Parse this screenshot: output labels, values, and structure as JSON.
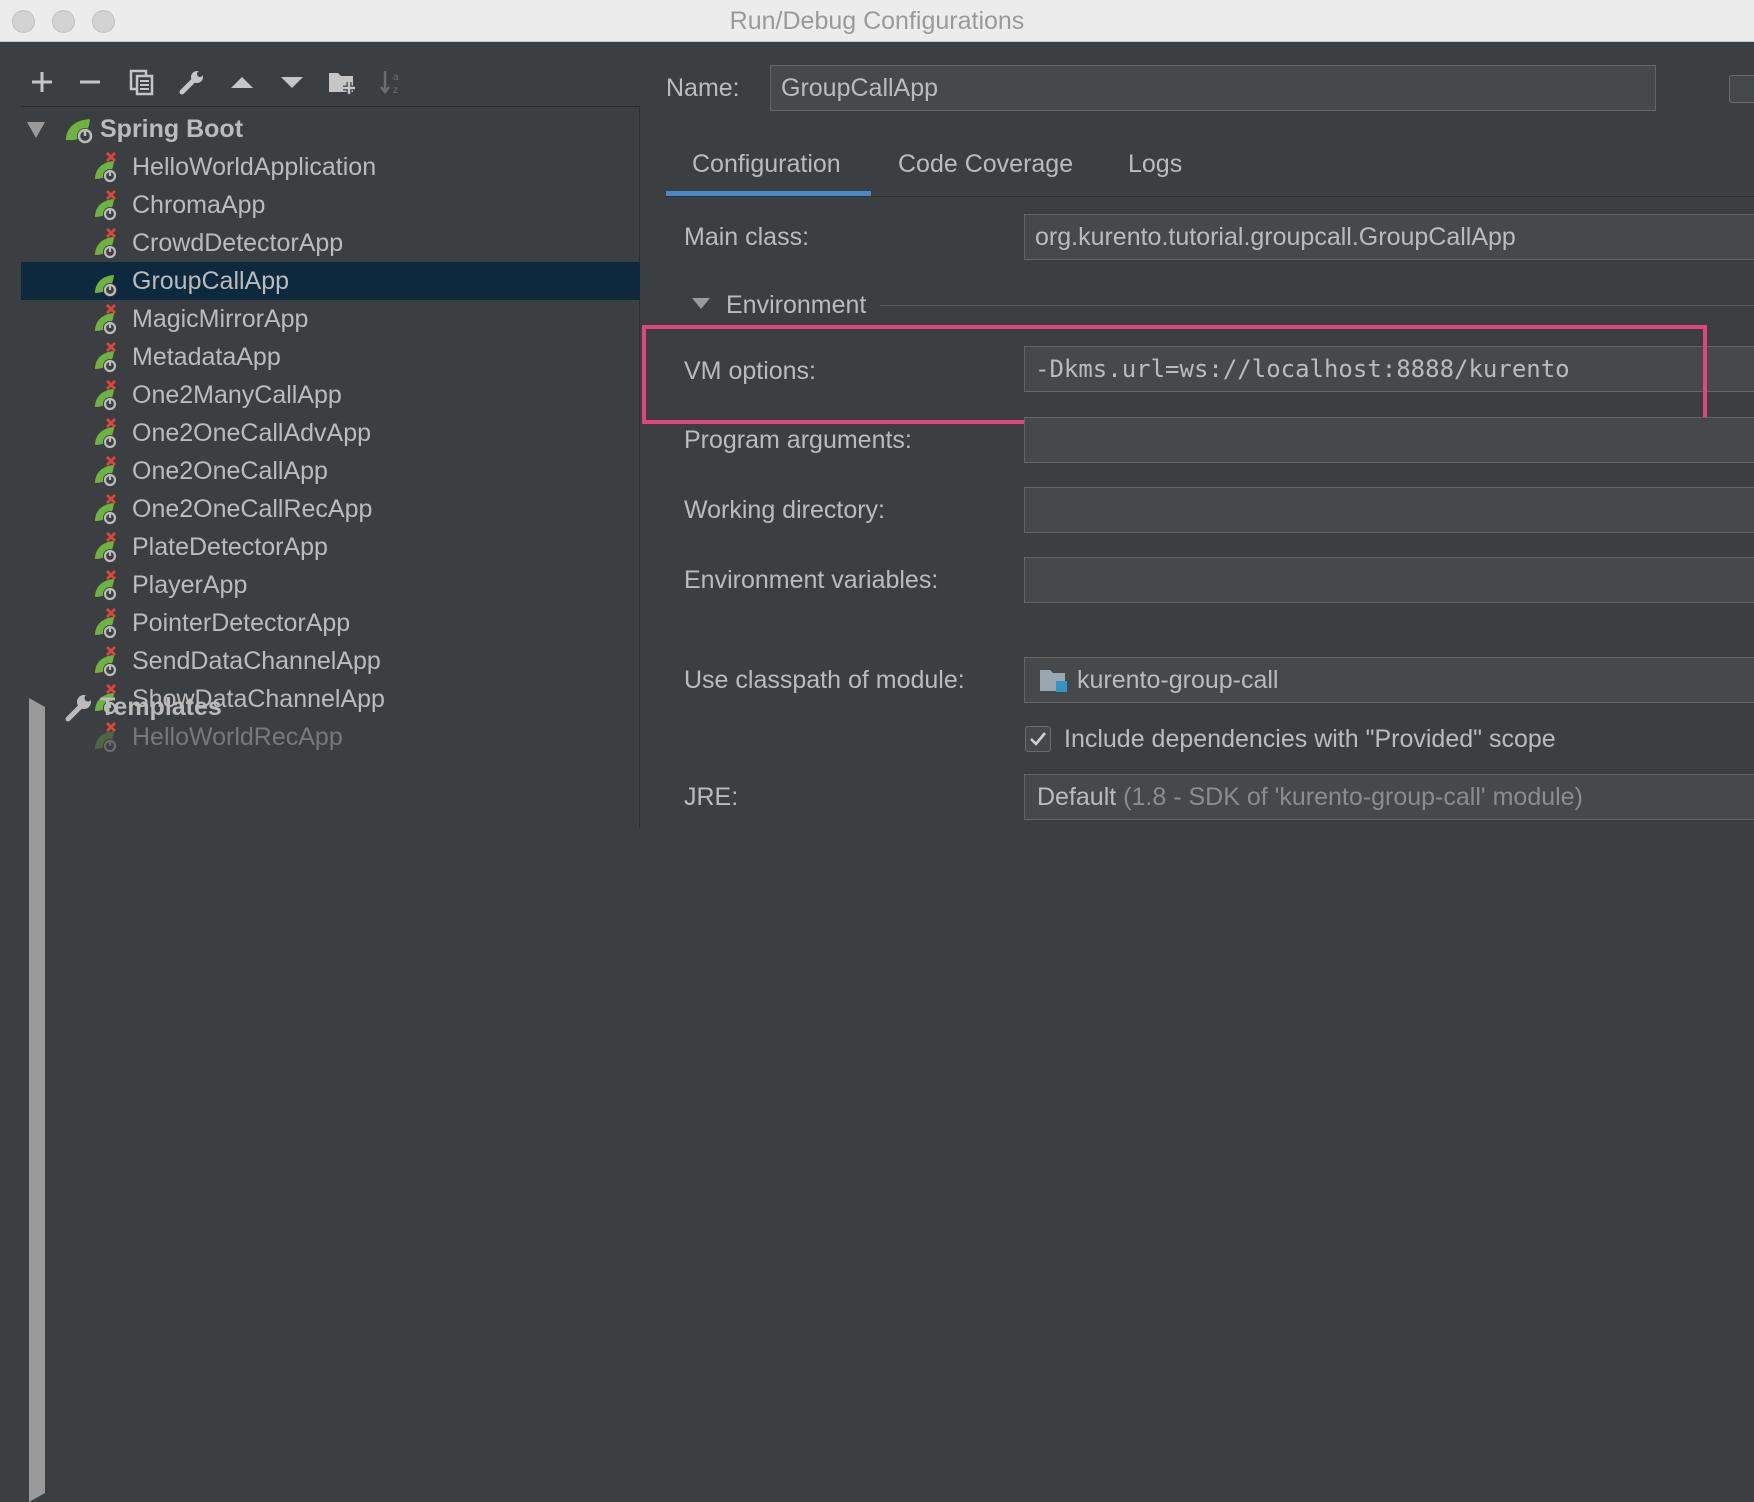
{
  "window": {
    "title": "Run/Debug Configurations"
  },
  "toolbar": {
    "buttons": [
      {
        "name": "add",
        "glyph": "+"
      },
      {
        "name": "remove",
        "glyph": "−"
      },
      {
        "name": "copy",
        "glyph": "copy-icon"
      },
      {
        "name": "edit-defaults",
        "glyph": "wrench-icon"
      },
      {
        "name": "move-up",
        "glyph": "▲"
      },
      {
        "name": "move-down",
        "glyph": "▼"
      },
      {
        "name": "new-folder",
        "glyph": "folder-plus-icon"
      },
      {
        "name": "sort",
        "glyph": "sort-az-icon"
      }
    ]
  },
  "tree": {
    "root_label": "Spring Boot",
    "items": [
      {
        "label": "HelloWorldApplication",
        "error": true
      },
      {
        "label": "ChromaApp",
        "error": true
      },
      {
        "label": "CrowdDetectorApp",
        "error": true
      },
      {
        "label": "GroupCallApp",
        "error": false,
        "selected": true
      },
      {
        "label": "MagicMirrorApp",
        "error": true
      },
      {
        "label": "MetadataApp",
        "error": true
      },
      {
        "label": "One2ManyCallApp",
        "error": true
      },
      {
        "label": "One2OneCallAdvApp",
        "error": true
      },
      {
        "label": "One2OneCallApp",
        "error": true
      },
      {
        "label": "One2OneCallRecApp",
        "error": true
      },
      {
        "label": "PlateDetectorApp",
        "error": true
      },
      {
        "label": "PlayerApp",
        "error": true
      },
      {
        "label": "PointerDetectorApp",
        "error": true
      },
      {
        "label": "SendDataChannelApp",
        "error": true
      },
      {
        "label": "ShowDataChannelApp",
        "error": true
      },
      {
        "label": "HelloWorldRecApp",
        "error": true,
        "disabled": true
      }
    ],
    "templates_label": "Templates"
  },
  "form": {
    "name_label": "Name:",
    "name_value": "GroupCallApp",
    "tabs": [
      "Configuration",
      "Code Coverage",
      "Logs"
    ],
    "main_class_label": "Main class:",
    "main_class_value": "org.kurento.tutorial.groupcall.GroupCallApp",
    "environment_label": "Environment",
    "vm_options_label": "VM options:",
    "vm_options_value": "-Dkms.url=ws://localhost:8888/kurento",
    "program_args_label": "Program arguments:",
    "program_args_value": "",
    "working_dir_label": "Working directory:",
    "working_dir_value": "",
    "env_vars_label": "Environment variables:",
    "env_vars_value": "",
    "classpath_label": "Use classpath of module:",
    "classpath_value": "kurento-group-call",
    "include_deps_label": "Include dependencies with \"Provided\" scope",
    "include_deps_checked": true,
    "jre_label": "JRE:",
    "jre_value": "Default",
    "jre_detail": "(1.8 - SDK of 'kurento-group-call' module)"
  },
  "colors": {
    "background": "#3c3f41",
    "selection": "#0d293e",
    "tab_accent": "#4a88c7",
    "highlight_box": "#e0457b",
    "error_x": "#e0453a",
    "spring_green": "#6db33f"
  }
}
